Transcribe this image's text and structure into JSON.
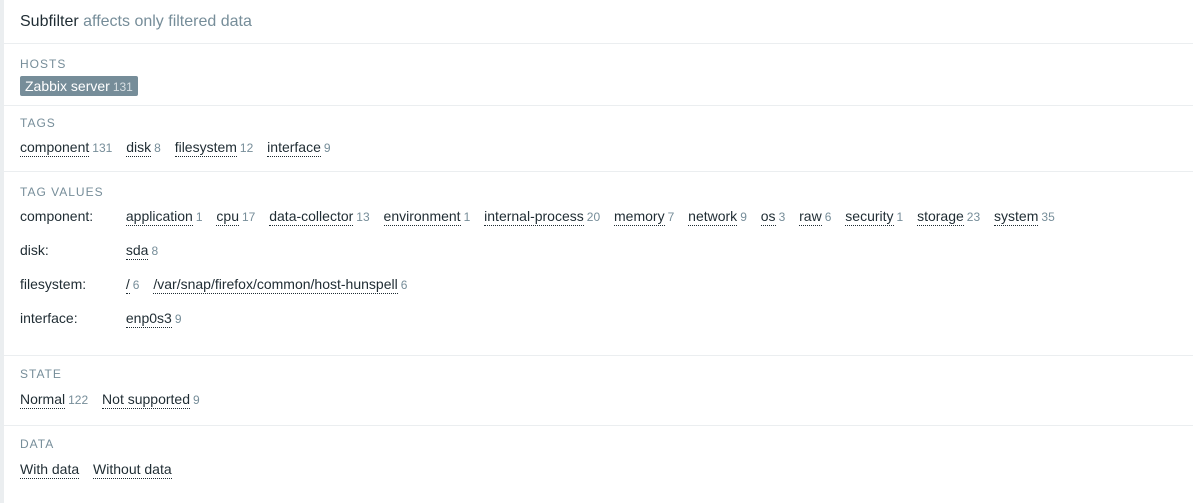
{
  "header": {
    "title": "Subfilter",
    "subtitle": "affects only filtered data"
  },
  "hosts": {
    "title": "HOSTS",
    "items": [
      {
        "label": "Zabbix server",
        "count": "131"
      }
    ]
  },
  "tags": {
    "title": "TAGS",
    "items": [
      {
        "label": "component",
        "count": "131"
      },
      {
        "label": "disk",
        "count": "8"
      },
      {
        "label": "filesystem",
        "count": "12"
      },
      {
        "label": "interface",
        "count": "9"
      }
    ]
  },
  "tag_values": {
    "title": "TAG VALUES",
    "rows": [
      {
        "name": "component:",
        "values": [
          {
            "label": "application",
            "count": "1"
          },
          {
            "label": "cpu",
            "count": "17"
          },
          {
            "label": "data-collector",
            "count": "13"
          },
          {
            "label": "environment",
            "count": "1"
          },
          {
            "label": "internal-process",
            "count": "20"
          },
          {
            "label": "memory",
            "count": "7"
          },
          {
            "label": "network",
            "count": "9"
          },
          {
            "label": "os",
            "count": "3"
          },
          {
            "label": "raw",
            "count": "6"
          },
          {
            "label": "security",
            "count": "1"
          },
          {
            "label": "storage",
            "count": "23"
          },
          {
            "label": "system",
            "count": "35"
          }
        ]
      },
      {
        "name": "disk:",
        "values": [
          {
            "label": "sda",
            "count": "8"
          }
        ]
      },
      {
        "name": "filesystem:",
        "values": [
          {
            "label": "/",
            "count": "6"
          },
          {
            "label": "/var/snap/firefox/common/host-hunspell",
            "count": "6"
          }
        ]
      },
      {
        "name": "interface:",
        "values": [
          {
            "label": "enp0s3",
            "count": "9"
          }
        ]
      }
    ]
  },
  "state": {
    "title": "STATE",
    "items": [
      {
        "label": "Normal",
        "count": "122"
      },
      {
        "label": "Not supported",
        "count": "9"
      }
    ]
  },
  "data": {
    "title": "DATA",
    "items": [
      {
        "label": "With data",
        "count": ""
      },
      {
        "label": "Without data",
        "count": ""
      }
    ]
  }
}
